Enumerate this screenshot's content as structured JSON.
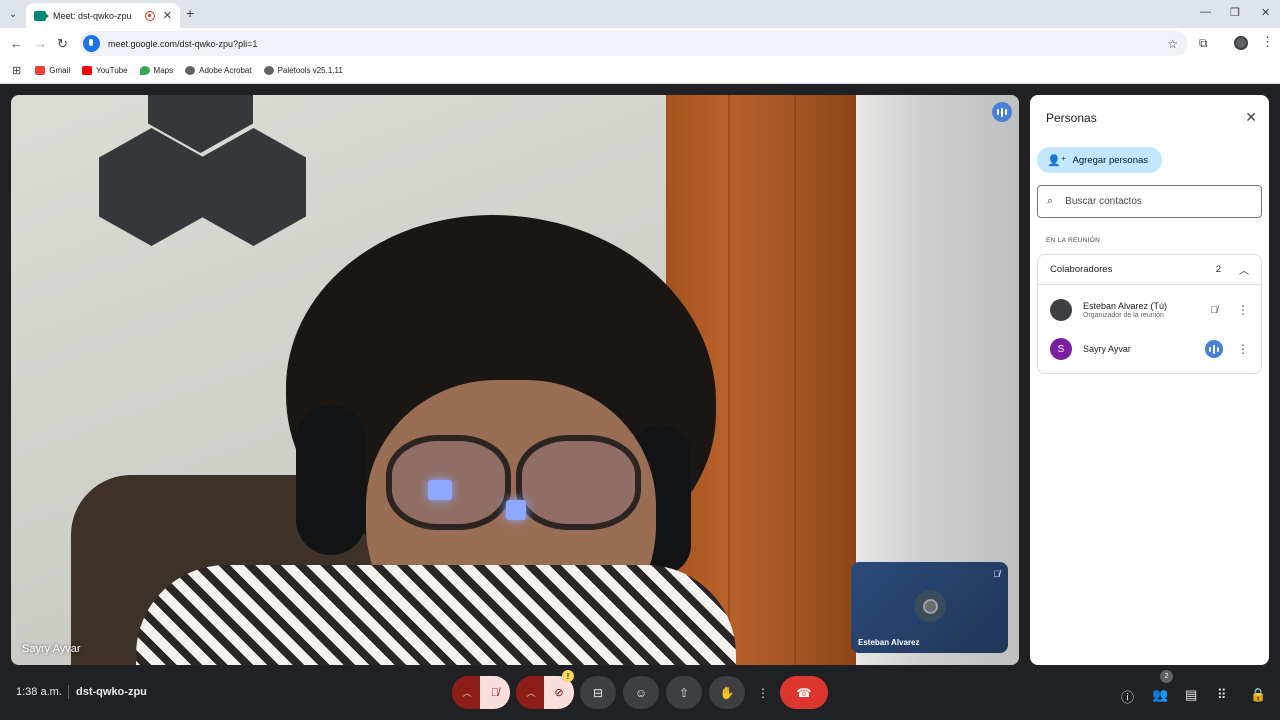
{
  "browser": {
    "tab_title": "Meet: dst-qwko-zpu",
    "url": "meet.google.com/dst-qwko-zpu?pli=1",
    "new_tab": "+",
    "bookmarks": [
      {
        "label": "Gmail",
        "icon": "gmail-icon",
        "color": "#ea4335"
      },
      {
        "label": "YouTube",
        "icon": "youtube-icon",
        "color": "#ff0000"
      },
      {
        "label": "Maps",
        "icon": "maps-icon",
        "color": "#34a853"
      },
      {
        "label": "Adobe Acrobat",
        "icon": "globe-icon",
        "color": "#5f6368"
      },
      {
        "label": "Paletools v25.1.11",
        "icon": "globe-icon",
        "color": "#5f6368"
      }
    ]
  },
  "meeting": {
    "main_speaker": "Sayry Ayvar",
    "self_tile_name": "Esteban Alvarez",
    "time": "1:38 a.m.",
    "code": "dst-qwko-zpu",
    "people_count_badge": "2",
    "camera_warning": "!"
  },
  "panel": {
    "title": "Personas",
    "add_people": "Agregar personas",
    "search_placeholder": "Buscar contactos",
    "section_label": "EN LA REUNIÓN",
    "group_label": "Colaboradores",
    "group_count": "2",
    "participants": [
      {
        "name": "Esteban Alvarez (Tú)",
        "subtitle": "Organizador de la reunión",
        "avatar_letter": "",
        "avatar_color": "#3c4043",
        "status": "muted"
      },
      {
        "name": "Sayry Ayvar",
        "subtitle": "",
        "avatar_letter": "S",
        "avatar_color": "#7b1fa2",
        "status": "speaking"
      }
    ]
  },
  "colors": {
    "accent": "#1a73e8",
    "end_call": "#dc362e",
    "muted_bg": "#8c1d18"
  }
}
